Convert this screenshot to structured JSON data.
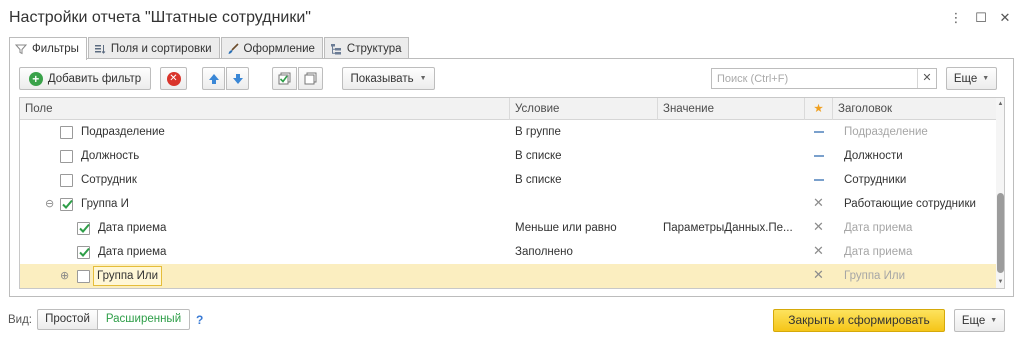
{
  "window": {
    "title": "Настройки отчета \"Штатные сотрудники\"",
    "controls": {
      "menu": "⋮",
      "restore": "☐",
      "close": "✕"
    }
  },
  "tabs": [
    {
      "label": "Фильтры",
      "icon": "funnel-icon",
      "active": true
    },
    {
      "label": "Поля и сортировки",
      "icon": "columns-sort-icon"
    },
    {
      "label": "Оформление",
      "icon": "brush-icon"
    },
    {
      "label": "Структура",
      "icon": "structure-icon"
    }
  ],
  "toolbar": {
    "add_filter_label": "Добавить фильтр",
    "show_label": "Показывать",
    "more_label": "Еще"
  },
  "search": {
    "placeholder": "Поиск (Ctrl+F)",
    "value": ""
  },
  "grid": {
    "columns": {
      "field": "Поле",
      "condition": "Условие",
      "value": "Значение",
      "star": "★",
      "title": "Заголовок"
    },
    "rows": [
      {
        "field": "Подразделение",
        "condition": "В группе",
        "value": "",
        "title": "Подразделение",
        "checked": false,
        "level": 1,
        "use": "dash",
        "title_muted": true
      },
      {
        "field": "Должность",
        "condition": "В списке",
        "value": "",
        "title": "Должности",
        "checked": false,
        "level": 1,
        "use": "dash",
        "title_muted": false
      },
      {
        "field": "Сотрудник",
        "condition": "В списке",
        "value": "",
        "title": "Сотрудники",
        "checked": false,
        "level": 1,
        "use": "dash",
        "title_muted": false
      },
      {
        "field": "Группа И",
        "condition": "",
        "value": "",
        "title": "Работающие сотрудники",
        "checked": true,
        "level": 1,
        "use": "x",
        "title_muted": false,
        "group": "expanded"
      },
      {
        "field": "Дата приема",
        "condition": "Меньше или равно",
        "value": "ПараметрыДанных.Пе...",
        "title": "Дата приема",
        "checked": true,
        "level": 2,
        "use": "x",
        "title_muted": true
      },
      {
        "field": "Дата приема",
        "condition": "Заполнено",
        "value": "",
        "title": "Дата приема",
        "checked": true,
        "level": 2,
        "use": "x",
        "title_muted": true
      },
      {
        "field": "Группа Или",
        "condition": "",
        "value": "",
        "title": "Группа Или",
        "checked": false,
        "level": 1,
        "use": "x",
        "title_muted": true,
        "group": "collapsed",
        "selected": true
      }
    ]
  },
  "footer": {
    "view_label": "Вид:",
    "simple_label": "Простой",
    "advanced_label": "Расширенный",
    "help_label": "?",
    "primary_label": "Закрыть и сформировать",
    "more_label": "Еще"
  },
  "colors": {
    "accent_green": "#2e9e48",
    "primary_yellow": "#f5c518",
    "selection": "#fbeec0"
  }
}
